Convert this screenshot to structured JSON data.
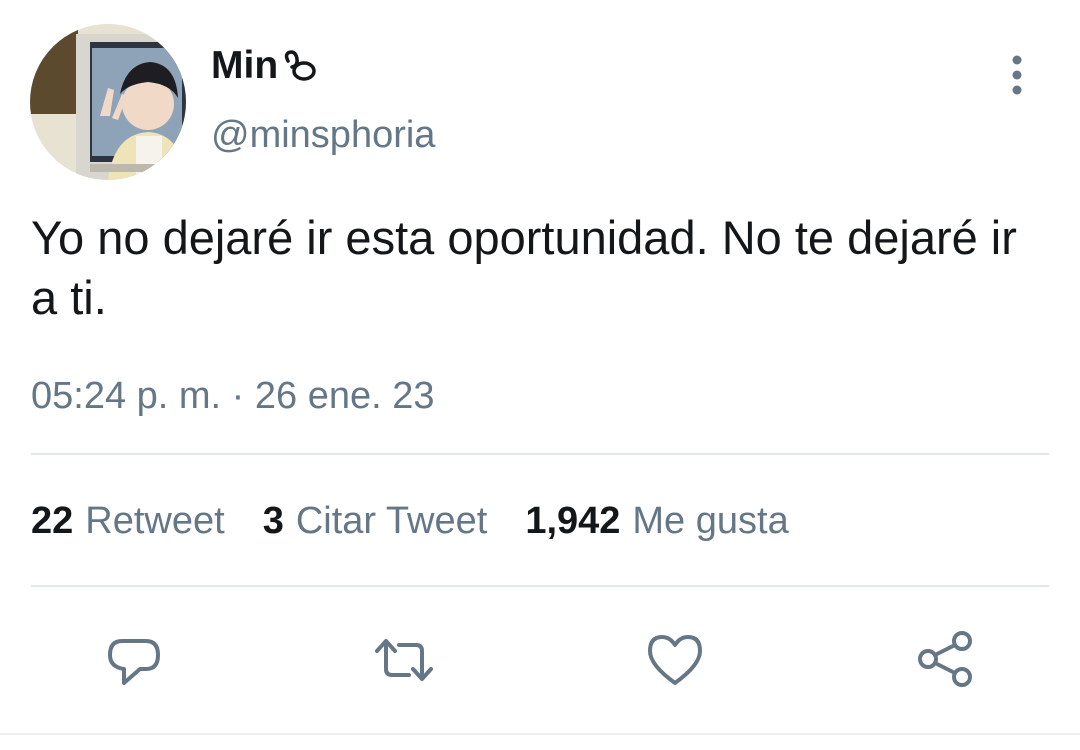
{
  "tweet": {
    "display_name": "Min",
    "name_emoji": "infinity-emoji",
    "handle": "@minsphoria",
    "text": "Yo no dejaré ir esta oportunidad. No te dejaré ir a ti.",
    "timestamp": "05:24 p. m. · 26 ene. 23"
  },
  "stats": [
    {
      "count": "22",
      "label": "Retweet"
    },
    {
      "count": "3",
      "label": "Citar Tweet"
    },
    {
      "count": "1,942",
      "label": "Me gusta"
    }
  ],
  "icons": {
    "more": "more-vertical-icon",
    "reply": "reply-icon",
    "retweet": "retweet-icon",
    "like": "heart-icon",
    "share": "share-icon"
  },
  "colors": {
    "text": "#14171a",
    "secondary": "#657786",
    "divider": "#e1e8ed"
  }
}
